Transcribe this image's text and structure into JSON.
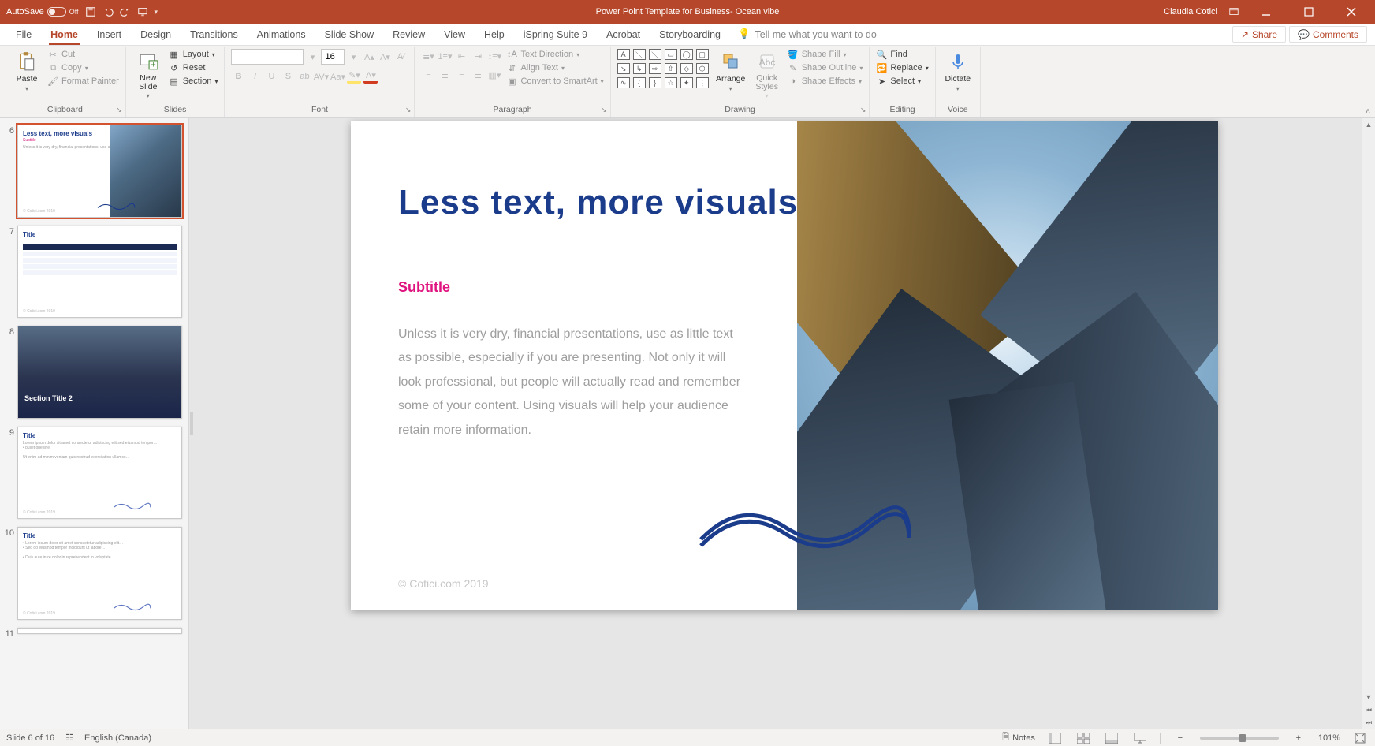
{
  "titlebar": {
    "autosave_label": "AutoSave",
    "autosave_state": "Off",
    "doc_title": "Power Point Template for Business- Ocean vibe",
    "user_name": "Claudia Cotici"
  },
  "tabs": {
    "file": "File",
    "home": "Home",
    "insert": "Insert",
    "design": "Design",
    "transitions": "Transitions",
    "animations": "Animations",
    "slideshow": "Slide Show",
    "review": "Review",
    "view": "View",
    "help": "Help",
    "ispring": "iSpring Suite 9",
    "acrobat": "Acrobat",
    "storyboarding": "Storyboarding",
    "tellme": "Tell me what you want to do",
    "share": "Share",
    "comments": "Comments"
  },
  "ribbon": {
    "clipboard": {
      "group": "Clipboard",
      "paste": "Paste",
      "cut": "Cut",
      "copy": "Copy",
      "format_painter": "Format Painter"
    },
    "slides": {
      "group": "Slides",
      "new_slide": "New\nSlide",
      "layout": "Layout",
      "reset": "Reset",
      "section": "Section"
    },
    "font": {
      "group": "Font",
      "name": "",
      "size": "16"
    },
    "paragraph": {
      "group": "Paragraph",
      "text_direction": "Text Direction",
      "align_text": "Align Text",
      "convert_smartart": "Convert to SmartArt"
    },
    "drawing": {
      "group": "Drawing",
      "arrange": "Arrange",
      "quick_styles": "Quick\nStyles",
      "shape_fill": "Shape Fill",
      "shape_outline": "Shape Outline",
      "shape_effects": "Shape Effects"
    },
    "editing": {
      "group": "Editing",
      "find": "Find",
      "replace": "Replace",
      "select": "Select"
    },
    "voice": {
      "group": "Voice",
      "dictate": "Dictate"
    }
  },
  "thumb_numbers": [
    "6",
    "7",
    "8",
    "9",
    "10",
    "11"
  ],
  "thumb6": {
    "title": "Less text, more visuals",
    "sub": "Subtitle"
  },
  "thumb7": {
    "title": "Title"
  },
  "thumb8": {
    "title": "Section Title 2"
  },
  "thumb9": {
    "title": "Title"
  },
  "thumb10": {
    "title": "Title"
  },
  "slide": {
    "title": "Less text, more visuals",
    "subtitle": "Subtitle",
    "body": "Unless it is very dry, financial presentations, use as little text as possible, especially if you are presenting. Not only it will look professional, but people will actually read and remember some of your content. Using visuals will help your audience retain more information.",
    "copyright": "© Cotici.com 2019"
  },
  "status": {
    "slide_counter": "Slide 6 of 16",
    "language": "English (Canada)",
    "notes": "Notes",
    "zoom": "101%"
  }
}
